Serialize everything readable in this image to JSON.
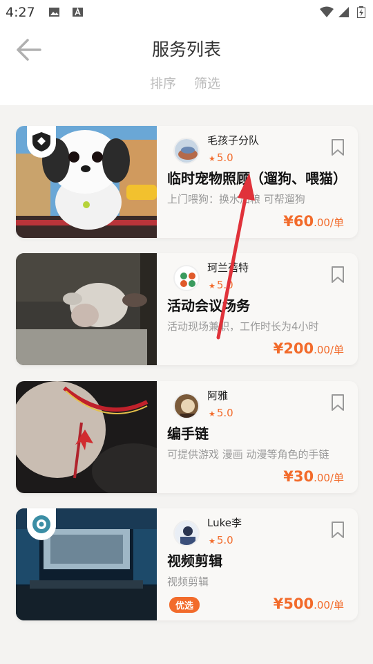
{
  "status_bar": {
    "time": "4:27"
  },
  "header": {
    "title": "服务列表",
    "sort_label": "排序",
    "filter_label": "筛选"
  },
  "colors": {
    "accent": "#f26b2b",
    "annotation_arrow": "#e0323a"
  },
  "services": [
    {
      "provider": "毛孩子分队",
      "rating": "5.0",
      "title": "临时宠物照顾（遛狗、喂猫）",
      "description": "上门喂狗：换水加粮 可帮遛狗",
      "price": "¥60",
      "price_unit": ".00/单",
      "badge_icon": "shield-logo-icon"
    },
    {
      "provider": "珂兰蓓特",
      "rating": "5.0",
      "title": "活动会议场务",
      "description": "活动现场兼职，工作时长为4小时",
      "price": "¥200",
      "price_unit": ".00/单"
    },
    {
      "provider": "阿雅",
      "rating": "5.0",
      "title": "编手链",
      "description": "可提供游戏 漫画 动漫等角色的手链",
      "price": "¥30",
      "price_unit": ".00/单"
    },
    {
      "provider": "Luke李",
      "rating": "5.0",
      "title": "视频剪辑",
      "description": "视频剪辑",
      "price": "¥500",
      "price_unit": ".00/单",
      "tag": "优选",
      "badge_icon": "circle-logo-icon"
    }
  ]
}
